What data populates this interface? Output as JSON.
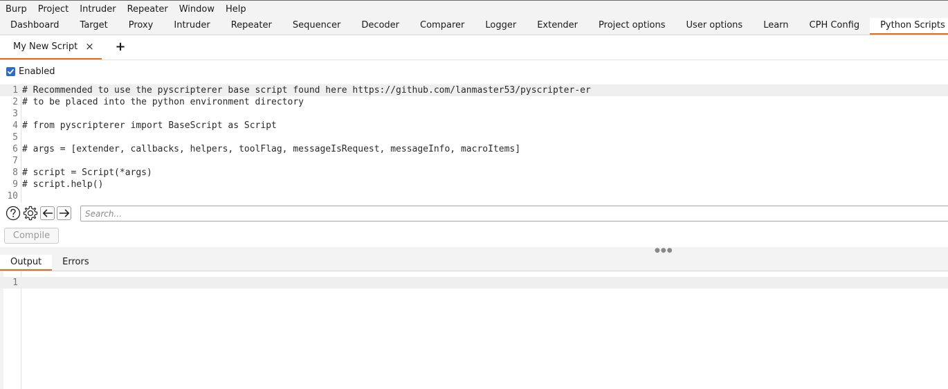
{
  "menu": [
    "Burp",
    "Project",
    "Intruder",
    "Repeater",
    "Window",
    "Help"
  ],
  "main_tabs": [
    "Dashboard",
    "Target",
    "Proxy",
    "Intruder",
    "Repeater",
    "Sequencer",
    "Decoder",
    "Comparer",
    "Logger",
    "Extender",
    "Project options",
    "User options",
    "Learn",
    "CPH Config",
    "Python Scripts"
  ],
  "active_main_tab": "Python Scripts",
  "script_tab": {
    "label": "My New Script",
    "close": "×",
    "add": "+"
  },
  "enabled": {
    "label": "Enabled",
    "checked": true
  },
  "code": {
    "line_numbers": [
      "1",
      "2",
      "3",
      "4",
      "5",
      "6",
      "7",
      "8",
      "9",
      "10"
    ],
    "lines": [
      "# Recommended to use the pyscripterer base script found here https://github.com/lanmaster53/pyscripter-er",
      "# to be placed into the python environment directory",
      "",
      "# from pyscripterer import BaseScript as Script",
      "",
      "# args = [extender, callbacks, helpers, toolFlag, messageIsRequest, messageInfo, macroItems]",
      "",
      "# script = Script(*args)",
      "# script.help()",
      ""
    ]
  },
  "search": {
    "placeholder": "Search..."
  },
  "compile_label": "Compile",
  "output_tabs": [
    "Output",
    "Errors"
  ],
  "active_output_tab": "Output",
  "output": {
    "line_numbers": [
      "1"
    ]
  },
  "colors": {
    "accent": "#e36b1b",
    "checkbox": "#2d6cc7"
  }
}
